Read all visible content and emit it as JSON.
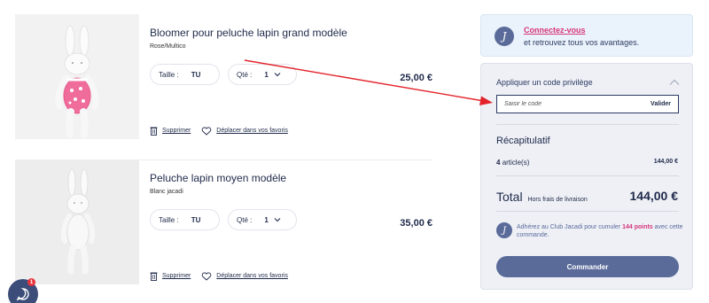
{
  "products": [
    {
      "name": "Bloomer pour peluche lapin grand modèle",
      "variant": "Rose/Multico",
      "size_label": "Taille :",
      "size_value": "TU",
      "qty_label": "Qté :",
      "qty_value": "1",
      "price": "25,00 €",
      "delete_label": "Supprimer",
      "favorite_label": "Déplacer dans vos favoris"
    },
    {
      "name": "Peluche lapin moyen modèle",
      "variant": "Blanc jacadi",
      "size_label": "Taille :",
      "size_value": "TU",
      "qty_label": "Qté :",
      "qty_value": "1",
      "price": "35,00 €",
      "delete_label": "Supprimer",
      "favorite_label": "Déplacer dans vos favoris"
    }
  ],
  "login": {
    "logo_letter": "J",
    "link": "Connectez-vous",
    "subtitle": "et retrouvez tous vos avantages."
  },
  "promo": {
    "title": "Appliquer un code privilège",
    "placeholder": "Saisir le code",
    "button": "Valider"
  },
  "recap": {
    "title": "Récapitulatif",
    "articles_count": "4",
    "articles_label": "article(s)",
    "articles_total": "144,00 €",
    "total_label": "Total",
    "total_note": "Hors frais de livraison",
    "total_value": "144,00 €",
    "club_text_before": "Adhérez au Club Jacadi pour cumuler",
    "club_points": "144 points",
    "club_text_after": "avec cette commande.",
    "order_button": "Commander"
  },
  "chat": {
    "badge": "1"
  },
  "colors": {
    "navy": "#1f2a4a",
    "accent_pink": "#d6347a",
    "button_blue": "#5a6b9a",
    "arrow_red": "#e3232a"
  },
  "icons": [
    "trash-icon",
    "heart-icon",
    "chevron-down-icon",
    "chevron-up-icon",
    "chat-icon",
    "jacadi-logo-icon"
  ]
}
